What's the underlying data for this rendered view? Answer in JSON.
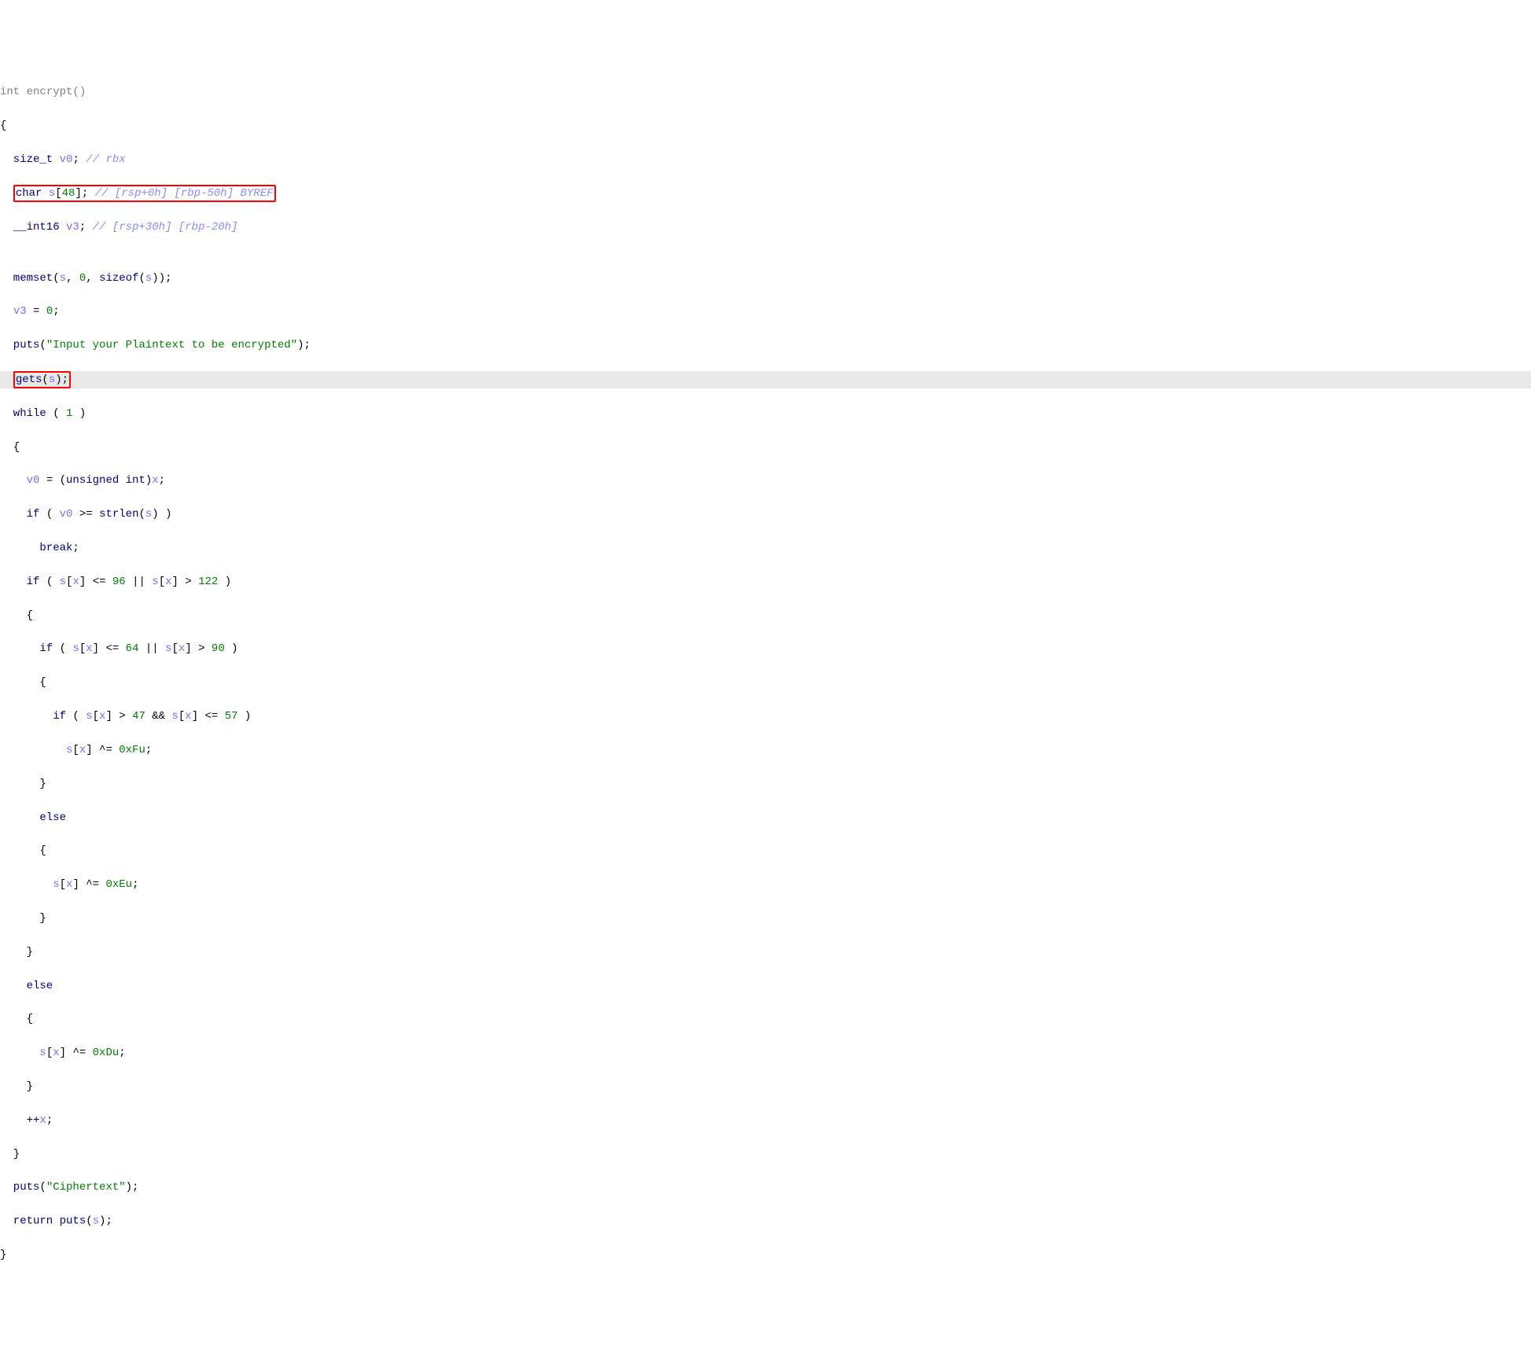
{
  "code": {
    "l1a": "int",
    "l1b": " encrypt()",
    "l2": "{",
    "l3a": "  size_t",
    "l3b": " ",
    "l3c": "v0",
    "l3d": "; ",
    "l3e": "// rbx",
    "l4a": "char",
    "l4b": " ",
    "l4c": "s",
    "l4d": "[",
    "l4e": "48",
    "l4f": "]; ",
    "l4g": "// [rsp+0h] [rbp-50h] BYREF",
    "l5a": "  __int16",
    "l5b": " ",
    "l5c": "v3",
    "l5d": "; ",
    "l5e": "// [rsp+30h] [rbp-20h]",
    "l6": "",
    "l7a": "  memset",
    "l7b": "(",
    "l7c": "s",
    "l7d": ", ",
    "l7e": "0",
    "l7f": ", ",
    "l7g": "sizeof",
    "l7h": "(",
    "l7i": "s",
    "l7j": "));",
    "l8a": "  ",
    "l8b": "v3",
    "l8c": " = ",
    "l8d": "0",
    "l8e": ";",
    "l9a": "  puts",
    "l9b": "(",
    "l9c": "\"Input your Plaintext to be encrypted\"",
    "l9d": ");",
    "l10pad": "  ",
    "l10a": "gets",
    "l10b": "(",
    "l10c": "s",
    "l10d": ");",
    "l11a": "  while",
    "l11b": " ( ",
    "l11c": "1",
    "l11d": " )",
    "l12": "  {",
    "l13a": "    ",
    "l13b": "v0",
    "l13c": " = (",
    "l13d": "unsigned int",
    "l13e": ")",
    "l13f": "x",
    "l13g": ";",
    "l14a": "    if",
    "l14b": " ( ",
    "l14c": "v0",
    "l14d": " >= ",
    "l14e": "strlen",
    "l14f": "(",
    "l14g": "s",
    "l14h": ") )",
    "l15a": "      break",
    "l15b": ";",
    "l16a": "    if",
    "l16b": " ( ",
    "l16c": "s",
    "l16d": "[",
    "l16e": "x",
    "l16f": "] <= ",
    "l16g": "96",
    "l16h": " || ",
    "l16i": "s",
    "l16j": "[",
    "l16k": "x",
    "l16l": "] > ",
    "l16m": "122",
    "l16n": " )",
    "l17": "    {",
    "l18a": "      if",
    "l18b": " ( ",
    "l18c": "s",
    "l18d": "[",
    "l18e": "x",
    "l18f": "] <= ",
    "l18g": "64",
    "l18h": " || ",
    "l18i": "s",
    "l18j": "[",
    "l18k": "x",
    "l18l": "] > ",
    "l18m": "90",
    "l18n": " )",
    "l19": "      {",
    "l20a": "        if",
    "l20b": " ( ",
    "l20c": "s",
    "l20d": "[",
    "l20e": "x",
    "l20f": "] > ",
    "l20g": "47",
    "l20h": " && ",
    "l20i": "s",
    "l20j": "[",
    "l20k": "x",
    "l20l": "] <= ",
    "l20m": "57",
    "l20n": " )",
    "l21a": "          ",
    "l21b": "s",
    "l21c": "[",
    "l21d": "x",
    "l21e": "] ^= ",
    "l21f": "0xFu",
    "l21g": ";",
    "l22": "      }",
    "l23a": "      else",
    "l24": "      {",
    "l25a": "        ",
    "l25b": "s",
    "l25c": "[",
    "l25d": "x",
    "l25e": "] ^= ",
    "l25f": "0xEu",
    "l25g": ";",
    "l26": "      }",
    "l27": "    }",
    "l28a": "    else",
    "l29": "    {",
    "l30a": "      ",
    "l30b": "s",
    "l30c": "[",
    "l30d": "x",
    "l30e": "] ^= ",
    "l30f": "0xDu",
    "l30g": ";",
    "l31": "    }",
    "l32a": "    ++",
    "l32b": "x",
    "l32c": ";",
    "l33": "  }",
    "l34a": "  puts",
    "l34b": "(",
    "l34c": "\"Ciphertext\"",
    "l34d": ");",
    "l35a": "  return",
    "l35b": " ",
    "l35c": "puts",
    "l35d": "(",
    "l35e": "s",
    "l35f": ");",
    "l36": "}"
  }
}
